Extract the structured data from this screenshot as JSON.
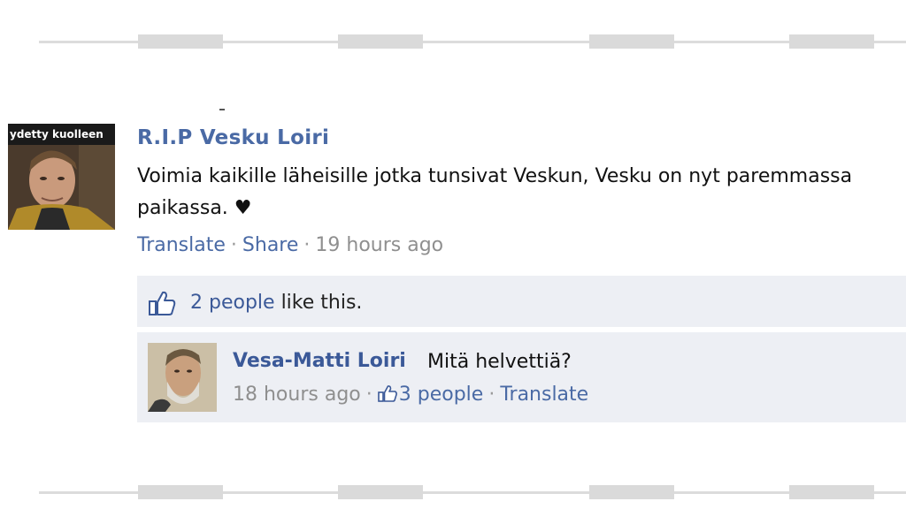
{
  "post": {
    "avatar_caption": "ydetty kuolleen",
    "author": "R.I.P Vesku Loiri",
    "text": "Voimia kaikille läheisille jotka tunsivat Veskun, Vesku on nyt paremmassa paikassa. ♥",
    "meta": {
      "translate_label": "Translate",
      "share_label": "Share",
      "separator": "·",
      "time": "19 hours ago"
    }
  },
  "likes": {
    "count_label": "2 people",
    "suffix": "like this."
  },
  "comment": {
    "author": "Vesa-Matti Loiri",
    "text": "Mitä helvettiä?",
    "meta": {
      "time": "18 hours ago",
      "separator": "·",
      "likes_label": "3 people",
      "translate_label": "Translate"
    }
  },
  "colors": {
    "link": "#3b5998",
    "meta": "#8f8f8f",
    "box_bg": "#edeff4"
  }
}
